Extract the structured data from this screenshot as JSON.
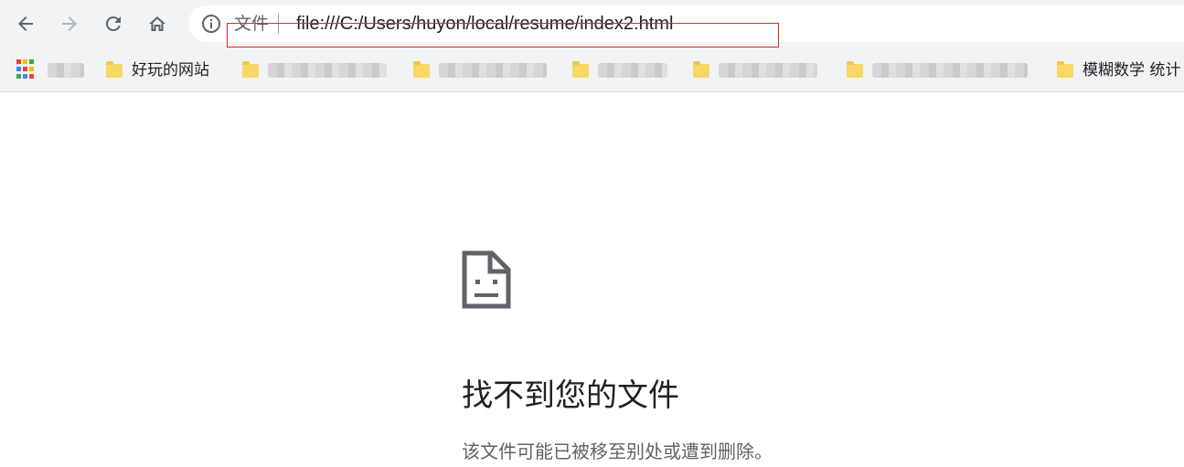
{
  "colors": {
    "toolbar_bg": "#f1f3f4",
    "annotation_box": "#e4262c",
    "folder": "#f8d865",
    "text_primary": "#202124",
    "text_secondary": "#5f6368"
  },
  "toolbar": {
    "back_icon": "arrow-left-icon",
    "forward_icon": "arrow-right-icon",
    "reload_icon": "reload-icon",
    "home_icon": "home-icon"
  },
  "omnibox": {
    "info_icon": "info-icon",
    "chip_label": "文件",
    "url": "file:///C:/Users/huyon/local/resume/index2.html"
  },
  "bookmarks": {
    "apps_icon": "apps-grid-icon",
    "items": [
      {
        "label": "好玩的网站"
      },
      {
        "label": ""
      },
      {
        "label": ""
      },
      {
        "label": ""
      },
      {
        "label": ""
      },
      {
        "label": ""
      },
      {
        "label": "模糊数学 统计"
      }
    ]
  },
  "error_page": {
    "icon": "sad-file-icon",
    "title": "找不到您的文件",
    "description": "该文件可能已被移至别处或遭到删除。"
  }
}
